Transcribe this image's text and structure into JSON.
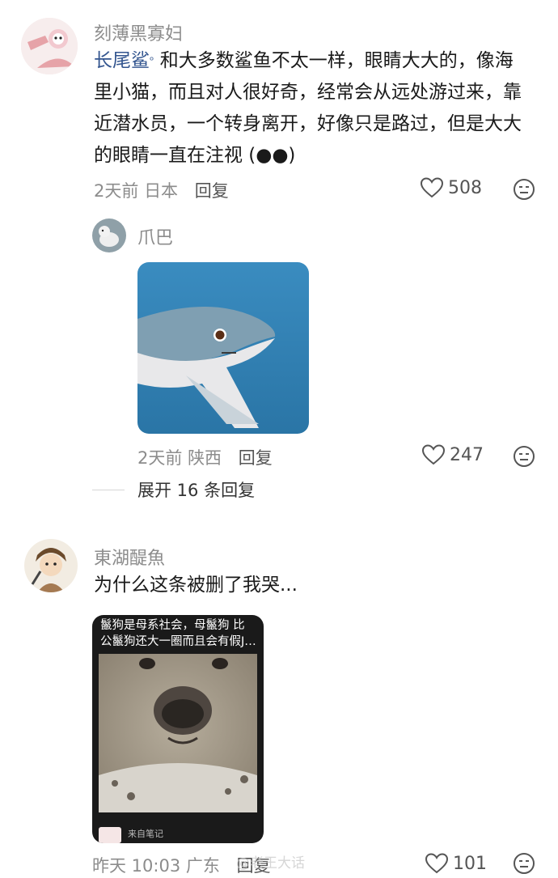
{
  "comments": [
    {
      "username": "刻薄黑寡妇",
      "topic": "长尾鲨",
      "text": " 和大多数鲨鱼不太一样，眼睛大大的，像海里小猫，而且对人很好奇，经常会从远处游过来，靠近潜水员，一个转身离开，好像只是路过，但是大大的眼睛一直在注视 (●●)",
      "time": "2天前",
      "location": "日本",
      "reply_label": "回复",
      "likes": "508",
      "reply": {
        "username": "爪巴",
        "time": "2天前",
        "location": "陕西",
        "reply_label": "回复",
        "likes": "247"
      },
      "expand_label": "展开 16 条回复"
    },
    {
      "username": "東湖醍魚",
      "text": "为什么这条被删了我哭...",
      "card": {
        "caption_line1": "鬣狗是母系社会，母鬣狗 比",
        "caption_line2": "公鬣狗还大一圈而且会有假J…",
        "source": "来自笔记"
      },
      "time": "昨天 10:03",
      "location": "广东",
      "reply_label": "回复",
      "likes": "101",
      "watermark": "@老王大话"
    }
  ],
  "colors": {
    "meta": "#8c8c8c",
    "topic": "#33558f",
    "shark_bg": "#2e7fb0"
  }
}
